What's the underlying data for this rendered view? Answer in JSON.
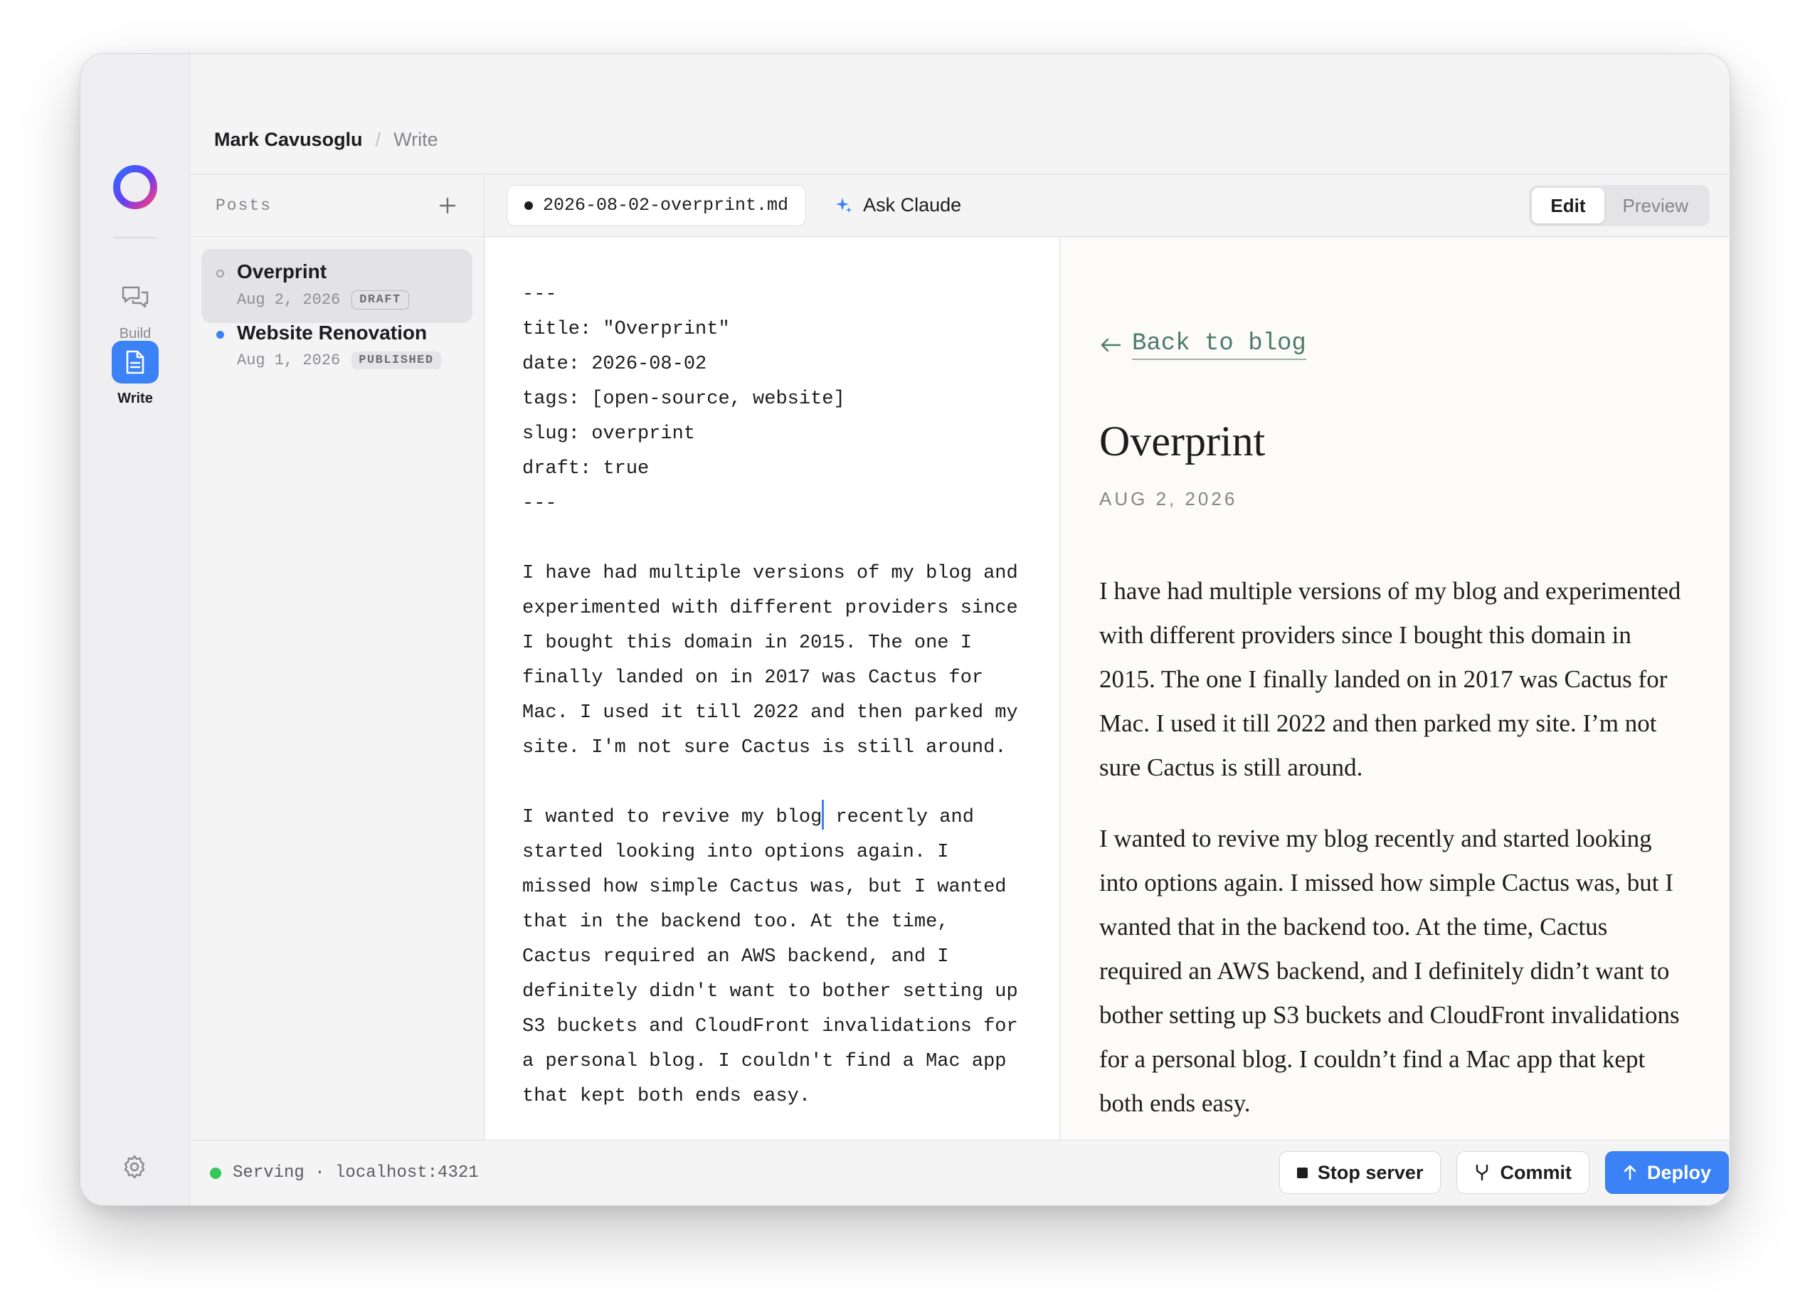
{
  "breadcrumb": {
    "owner": "Mark Cavusoglu",
    "separator": "/",
    "page": "Write"
  },
  "rail": {
    "build_label": "Build",
    "write_label": "Write"
  },
  "posts": {
    "title": "Posts",
    "items": [
      {
        "title": "Overprint",
        "date": "Aug 2, 2026",
        "badge": "DRAFT",
        "selected": true
      },
      {
        "title": "Website Renovation",
        "date": "Aug 1, 2026",
        "badge": "PUBLISHED",
        "selected": false
      }
    ]
  },
  "toolbar": {
    "file_name": "2026-08-02-overprint.md",
    "ask_label": "Ask Claude",
    "edit_label": "Edit",
    "preview_label": "Preview"
  },
  "editor": {
    "lines": [
      "---",
      "title: \"Overprint\"",
      "date: 2026-08-02",
      "tags: [open-source, website]",
      "slug: overprint",
      "draft: true",
      "---",
      "",
      "I have had multiple versions of my blog and",
      "experimented with different providers since",
      "I bought this domain in 2015. The one I",
      "finally landed on in 2017 was Cactus for",
      "Mac. I used it till 2022 and then parked my",
      "site. I'm not sure Cactus is still around.",
      "",
      "I wanted to revive my blog",
      "started looking into options again. I",
      "missed how simple Cactus was, but I wanted",
      "that in the backend too. At the time,",
      "Cactus required an AWS backend, and I",
      "definitely didn't want to bother setting up",
      "S3 buckets and CloudFront invalidations for",
      "a personal blog. I couldn't find a Mac app",
      "that kept both ends easy."
    ],
    "caret_tail": " recently and"
  },
  "preview": {
    "back_label": "Back to blog",
    "title": "Overprint",
    "date": "AUG 2, 2026",
    "paragraphs": [
      "I have had multiple versions of my blog and experimented with different providers since I bought this domain in 2015. The one I finally landed on in 2017 was Cactus for Mac. I used it till 2022 and then parked my site. I’m not sure Cactus is still around.",
      "I wanted to revive my blog recently and started looking into options again. I missed how simple Cactus was, but I wanted that in the backend too. At the time, Cactus required an AWS backend, and I definitely didn’t want to bother setting up S3 buckets and CloudFront invalidations for a personal blog. I couldn’t find a Mac app that kept both ends easy."
    ]
  },
  "status": {
    "serving_text": "Serving · localhost:4321",
    "stop_label": "Stop server",
    "commit_label": "Commit",
    "deploy_label": "Deploy"
  },
  "colors": {
    "accent": "#3b82f6",
    "serving": "#34c759",
    "link": "#4d7a6e"
  },
  "icons": {
    "add": "plus-icon",
    "ask": "sparkle-icon",
    "build": "chat-bubbles-icon",
    "write": "document-icon",
    "settings": "gear-icon",
    "commit": "git-branch-icon",
    "deploy": "arrow-up-icon",
    "back": "arrow-left-icon"
  }
}
